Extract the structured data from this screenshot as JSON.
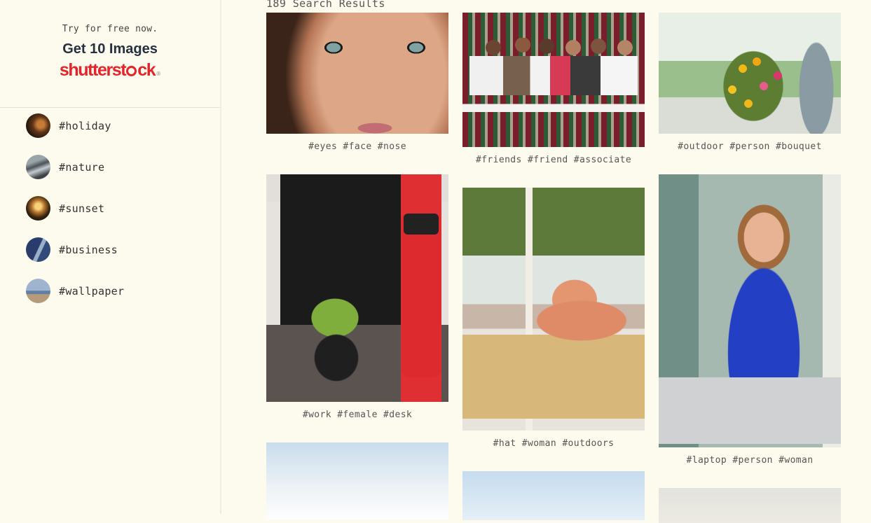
{
  "sidebar": {
    "promo": {
      "tagline": "Try for free now.",
      "headline": "Get 10 Images",
      "logo_text_before": "shutterst",
      "logo_text_after": "ck",
      "logo_trademark": "®",
      "brand_color": "#e3242b"
    },
    "tags": [
      {
        "label": "#holiday",
        "thumb_colors": [
          "#2b1a10",
          "#9a5c2c"
        ]
      },
      {
        "label": "#nature",
        "thumb_colors": [
          "#4a5056",
          "#a9b2b8"
        ]
      },
      {
        "label": "#sunset",
        "thumb_colors": [
          "#2a1608",
          "#f0b64a"
        ]
      },
      {
        "label": "#business",
        "thumb_colors": [
          "#1f2e55",
          "#8fa8c4"
        ]
      },
      {
        "label": "#wallpaper",
        "thumb_colors": [
          "#8fa6c2",
          "#9b7a5a"
        ]
      }
    ]
  },
  "main": {
    "results_label": "189 Search Results",
    "cards": [
      {
        "caption": "#eyes #face #nose"
      },
      {
        "caption": "#friends #friend #associate"
      },
      {
        "caption": "#outdoor #person #bouquet"
      },
      {
        "caption": "#work #female #desk"
      },
      {
        "caption": "#hat #woman #outdoors"
      },
      {
        "caption": "#laptop #person #woman"
      }
    ]
  },
  "colors": {
    "page_background": "#fdfbee",
    "text": "#555555"
  }
}
